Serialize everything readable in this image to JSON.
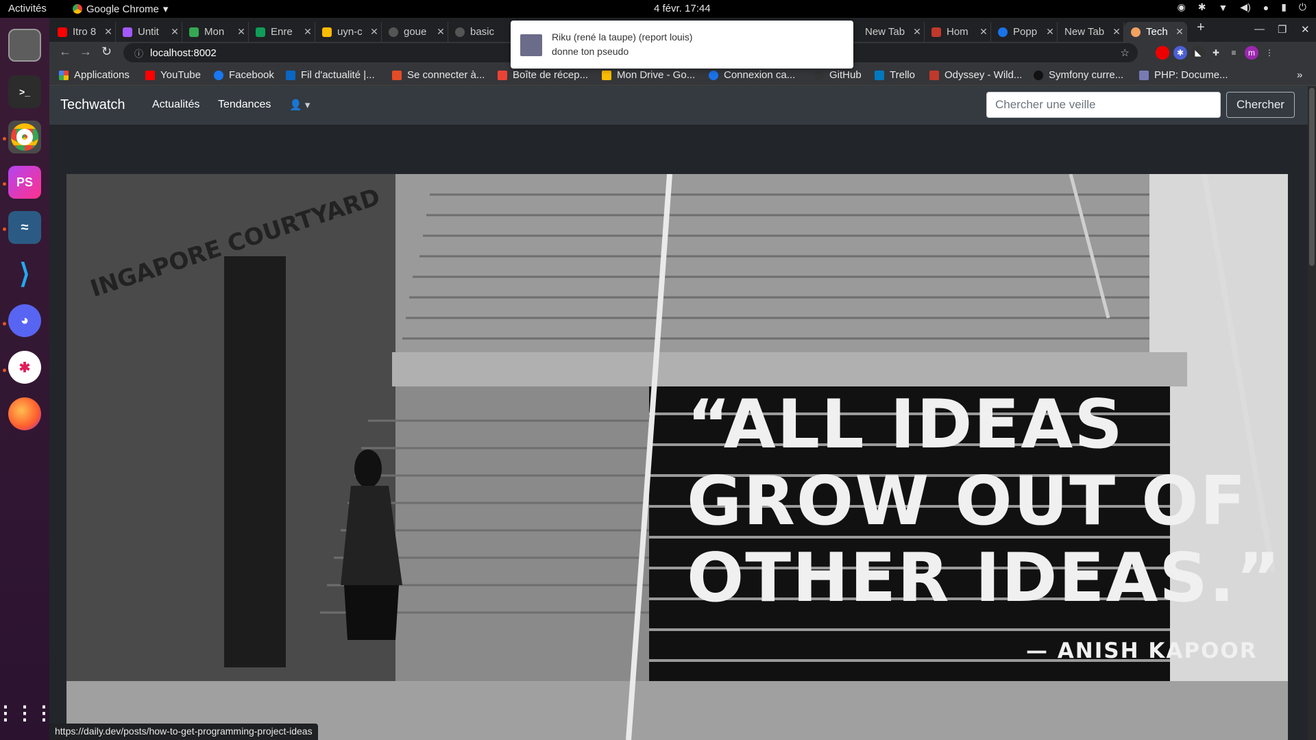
{
  "system": {
    "activities": "Activités",
    "app_name": "Google Chrome",
    "clock": "4 févr.  17:44"
  },
  "dock": [
    "files-icon",
    "terminal-icon",
    "chrome-icon",
    "phpstorm-icon",
    "mysql-workbench-icon",
    "vscode-icon",
    "discord-icon",
    "slack-icon",
    "firefox-icon",
    "app-grid-icon"
  ],
  "tabs": [
    {
      "label": "Itro 8",
      "color": "#ff0000"
    },
    {
      "label": "Untit",
      "color": "#a259ff"
    },
    {
      "label": "Mon",
      "color": "#34a853"
    },
    {
      "label": "Enre",
      "color": "#0f9d58"
    },
    {
      "label": "uyn-c",
      "color": "#fbbc04"
    },
    {
      "label": "goue",
      "color": "#555555"
    },
    {
      "label": "basic",
      "color": "#555555"
    },
    {
      "label": "New Tab",
      "color": ""
    },
    {
      "label": "Hom",
      "color": "#c0392b"
    },
    {
      "label": "Popp",
      "color": "#1a73e8"
    },
    {
      "label": "New Tab",
      "color": ""
    },
    {
      "label": "Tech",
      "color": "#f4a261"
    }
  ],
  "address": "localhost:8002",
  "bookmarks": [
    {
      "label": "Applications",
      "color": "#ea4335"
    },
    {
      "label": "YouTube",
      "color": "#ff0000"
    },
    {
      "label": "Facebook",
      "color": "#1877f2"
    },
    {
      "label": "Fil d'actualité |...",
      "color": "#0a66c2"
    },
    {
      "label": "Se connecter à...",
      "color": "#e34c26"
    },
    {
      "label": "Boîte de récep...",
      "color": "#ea4335"
    },
    {
      "label": "Mon Drive - Go...",
      "color": "#fbbc04"
    },
    {
      "label": "Connexion ca...",
      "color": "#1a73e8"
    },
    {
      "label": "GitHub",
      "color": "#333333"
    },
    {
      "label": "Trello",
      "color": "#0079bf"
    },
    {
      "label": "Odyssey - Wild...",
      "color": "#c0392b"
    },
    {
      "label": "Symfony curre...",
      "color": "#111111"
    },
    {
      "label": "PHP: Docume...",
      "color": "#777bb3"
    }
  ],
  "site": {
    "brand": "Techwatch",
    "nav": [
      "Actualités",
      "Tendances"
    ],
    "search_placeholder": "Chercher une veille",
    "search_button": "Chercher"
  },
  "hero": {
    "quote": "“ALL IDEAS GROW OUT OF OTHER IDEAS.”",
    "author": "— ANISH KAPOOR",
    "wall_sign": "INGAPORE COURTYARD"
  },
  "notification": {
    "title": "Riku (rené la taupe) (report louis)",
    "body": "donne ton pseudo"
  },
  "status_url": "https://daily.dev/posts/how-to-get-programming-project-ideas"
}
